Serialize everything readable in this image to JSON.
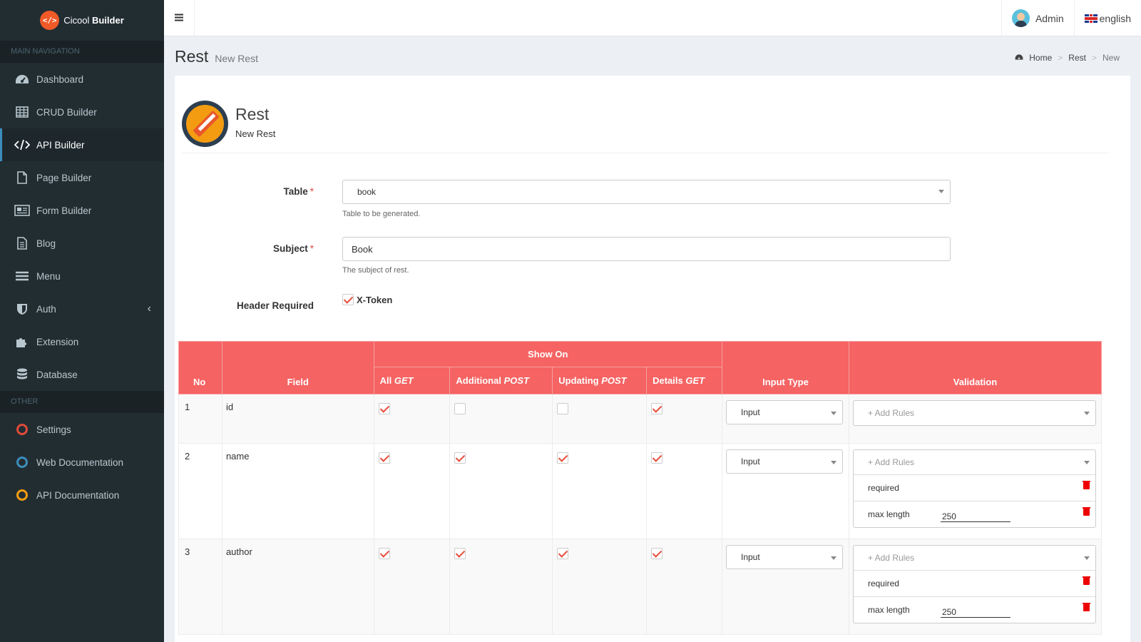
{
  "app": {
    "brand_first": "Cicool",
    "brand_second": "Builder",
    "logo_icon": "code-icon"
  },
  "sidebar": {
    "main_header": "MAIN NAVIGATION",
    "items": [
      {
        "label": "Dashboard",
        "icon": "dashboard-icon"
      },
      {
        "label": "CRUD Builder",
        "icon": "table-icon"
      },
      {
        "label": "API Builder",
        "icon": "code-icon",
        "active": true
      },
      {
        "label": "Page Builder",
        "icon": "file-icon"
      },
      {
        "label": "Form Builder",
        "icon": "form-icon"
      },
      {
        "label": "Blog",
        "icon": "document-icon"
      },
      {
        "label": "Menu",
        "icon": "bars-icon"
      },
      {
        "label": "Auth",
        "icon": "shield-icon"
      },
      {
        "label": "Extension",
        "icon": "puzzle-icon"
      },
      {
        "label": "Database",
        "icon": "database-icon"
      }
    ],
    "other_header": "OTHER",
    "other_items": [
      {
        "label": "Settings",
        "color": "#dd4b39"
      },
      {
        "label": "Web Documentation",
        "color": "#3c8dbc"
      },
      {
        "label": "API Documentation",
        "color": "#f39c12"
      }
    ]
  },
  "topbar": {
    "user": "Admin",
    "language": "english"
  },
  "header": {
    "title": "Rest",
    "subtitle": "New Rest"
  },
  "breadcrumb": {
    "home": "Home",
    "section": "Rest",
    "current": "New"
  },
  "box": {
    "title": "Rest",
    "subtitle": "New Rest"
  },
  "form": {
    "table": {
      "label": "Table",
      "value": "book",
      "help": "Table to be generated."
    },
    "subject": {
      "label": "Subject",
      "value": "Book",
      "help": "The subject of rest."
    },
    "header_required": {
      "label": "Header Required",
      "option": "X-Token",
      "checked": true
    }
  },
  "table": {
    "headers": {
      "no": "No",
      "field": "Field",
      "show_on": "Show On",
      "all": "All",
      "all_method": "GET",
      "additional": "Additional",
      "additional_method": "POST",
      "updating": "Updating",
      "updating_method": "POST",
      "details": "Details",
      "details_method": "GET",
      "input_type": "Input Type",
      "validation": "Validation"
    },
    "add_rules_placeholder": "+ Add Rules",
    "rows": [
      {
        "no": "1",
        "field": "id",
        "all": true,
        "additional": false,
        "updating": false,
        "details": true,
        "input_type": "Input",
        "rules": []
      },
      {
        "no": "2",
        "field": "name",
        "all": true,
        "additional": true,
        "updating": true,
        "details": true,
        "input_type": "Input",
        "rules": [
          {
            "name": "required",
            "value": ""
          },
          {
            "name": "max length",
            "value": "250"
          }
        ]
      },
      {
        "no": "3",
        "field": "author",
        "all": true,
        "additional": true,
        "updating": true,
        "details": true,
        "input_type": "Input",
        "rules": [
          {
            "name": "required",
            "value": ""
          },
          {
            "name": "max length",
            "value": "250"
          }
        ]
      }
    ]
  }
}
